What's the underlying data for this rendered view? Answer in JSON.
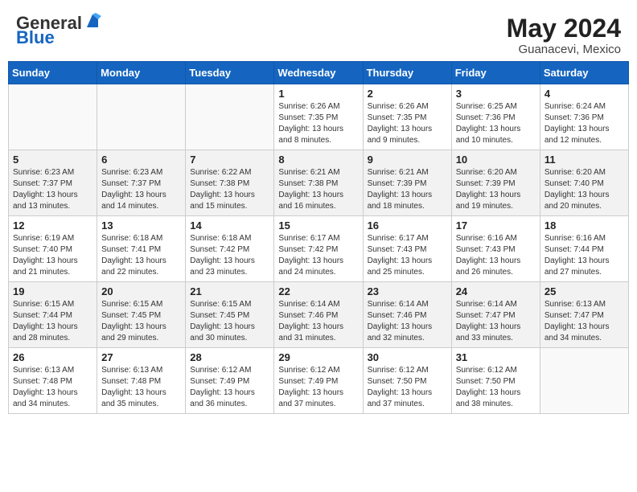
{
  "header": {
    "logo_general": "General",
    "logo_blue": "Blue",
    "title": "May 2024",
    "location": "Guanacevi, Mexico"
  },
  "days_of_week": [
    "Sunday",
    "Monday",
    "Tuesday",
    "Wednesday",
    "Thursday",
    "Friday",
    "Saturday"
  ],
  "weeks": [
    {
      "shaded": false,
      "days": [
        {
          "num": "",
          "info": ""
        },
        {
          "num": "",
          "info": ""
        },
        {
          "num": "",
          "info": ""
        },
        {
          "num": "1",
          "info": "Sunrise: 6:26 AM\nSunset: 7:35 PM\nDaylight: 13 hours\nand 8 minutes."
        },
        {
          "num": "2",
          "info": "Sunrise: 6:26 AM\nSunset: 7:35 PM\nDaylight: 13 hours\nand 9 minutes."
        },
        {
          "num": "3",
          "info": "Sunrise: 6:25 AM\nSunset: 7:36 PM\nDaylight: 13 hours\nand 10 minutes."
        },
        {
          "num": "4",
          "info": "Sunrise: 6:24 AM\nSunset: 7:36 PM\nDaylight: 13 hours\nand 12 minutes."
        }
      ]
    },
    {
      "shaded": true,
      "days": [
        {
          "num": "5",
          "info": "Sunrise: 6:23 AM\nSunset: 7:37 PM\nDaylight: 13 hours\nand 13 minutes."
        },
        {
          "num": "6",
          "info": "Sunrise: 6:23 AM\nSunset: 7:37 PM\nDaylight: 13 hours\nand 14 minutes."
        },
        {
          "num": "7",
          "info": "Sunrise: 6:22 AM\nSunset: 7:38 PM\nDaylight: 13 hours\nand 15 minutes."
        },
        {
          "num": "8",
          "info": "Sunrise: 6:21 AM\nSunset: 7:38 PM\nDaylight: 13 hours\nand 16 minutes."
        },
        {
          "num": "9",
          "info": "Sunrise: 6:21 AM\nSunset: 7:39 PM\nDaylight: 13 hours\nand 18 minutes."
        },
        {
          "num": "10",
          "info": "Sunrise: 6:20 AM\nSunset: 7:39 PM\nDaylight: 13 hours\nand 19 minutes."
        },
        {
          "num": "11",
          "info": "Sunrise: 6:20 AM\nSunset: 7:40 PM\nDaylight: 13 hours\nand 20 minutes."
        }
      ]
    },
    {
      "shaded": false,
      "days": [
        {
          "num": "12",
          "info": "Sunrise: 6:19 AM\nSunset: 7:40 PM\nDaylight: 13 hours\nand 21 minutes."
        },
        {
          "num": "13",
          "info": "Sunrise: 6:18 AM\nSunset: 7:41 PM\nDaylight: 13 hours\nand 22 minutes."
        },
        {
          "num": "14",
          "info": "Sunrise: 6:18 AM\nSunset: 7:42 PM\nDaylight: 13 hours\nand 23 minutes."
        },
        {
          "num": "15",
          "info": "Sunrise: 6:17 AM\nSunset: 7:42 PM\nDaylight: 13 hours\nand 24 minutes."
        },
        {
          "num": "16",
          "info": "Sunrise: 6:17 AM\nSunset: 7:43 PM\nDaylight: 13 hours\nand 25 minutes."
        },
        {
          "num": "17",
          "info": "Sunrise: 6:16 AM\nSunset: 7:43 PM\nDaylight: 13 hours\nand 26 minutes."
        },
        {
          "num": "18",
          "info": "Sunrise: 6:16 AM\nSunset: 7:44 PM\nDaylight: 13 hours\nand 27 minutes."
        }
      ]
    },
    {
      "shaded": true,
      "days": [
        {
          "num": "19",
          "info": "Sunrise: 6:15 AM\nSunset: 7:44 PM\nDaylight: 13 hours\nand 28 minutes."
        },
        {
          "num": "20",
          "info": "Sunrise: 6:15 AM\nSunset: 7:45 PM\nDaylight: 13 hours\nand 29 minutes."
        },
        {
          "num": "21",
          "info": "Sunrise: 6:15 AM\nSunset: 7:45 PM\nDaylight: 13 hours\nand 30 minutes."
        },
        {
          "num": "22",
          "info": "Sunrise: 6:14 AM\nSunset: 7:46 PM\nDaylight: 13 hours\nand 31 minutes."
        },
        {
          "num": "23",
          "info": "Sunrise: 6:14 AM\nSunset: 7:46 PM\nDaylight: 13 hours\nand 32 minutes."
        },
        {
          "num": "24",
          "info": "Sunrise: 6:14 AM\nSunset: 7:47 PM\nDaylight: 13 hours\nand 33 minutes."
        },
        {
          "num": "25",
          "info": "Sunrise: 6:13 AM\nSunset: 7:47 PM\nDaylight: 13 hours\nand 34 minutes."
        }
      ]
    },
    {
      "shaded": false,
      "days": [
        {
          "num": "26",
          "info": "Sunrise: 6:13 AM\nSunset: 7:48 PM\nDaylight: 13 hours\nand 34 minutes."
        },
        {
          "num": "27",
          "info": "Sunrise: 6:13 AM\nSunset: 7:48 PM\nDaylight: 13 hours\nand 35 minutes."
        },
        {
          "num": "28",
          "info": "Sunrise: 6:12 AM\nSunset: 7:49 PM\nDaylight: 13 hours\nand 36 minutes."
        },
        {
          "num": "29",
          "info": "Sunrise: 6:12 AM\nSunset: 7:49 PM\nDaylight: 13 hours\nand 37 minutes."
        },
        {
          "num": "30",
          "info": "Sunrise: 6:12 AM\nSunset: 7:50 PM\nDaylight: 13 hours\nand 37 minutes."
        },
        {
          "num": "31",
          "info": "Sunrise: 6:12 AM\nSunset: 7:50 PM\nDaylight: 13 hours\nand 38 minutes."
        },
        {
          "num": "",
          "info": ""
        }
      ]
    }
  ]
}
